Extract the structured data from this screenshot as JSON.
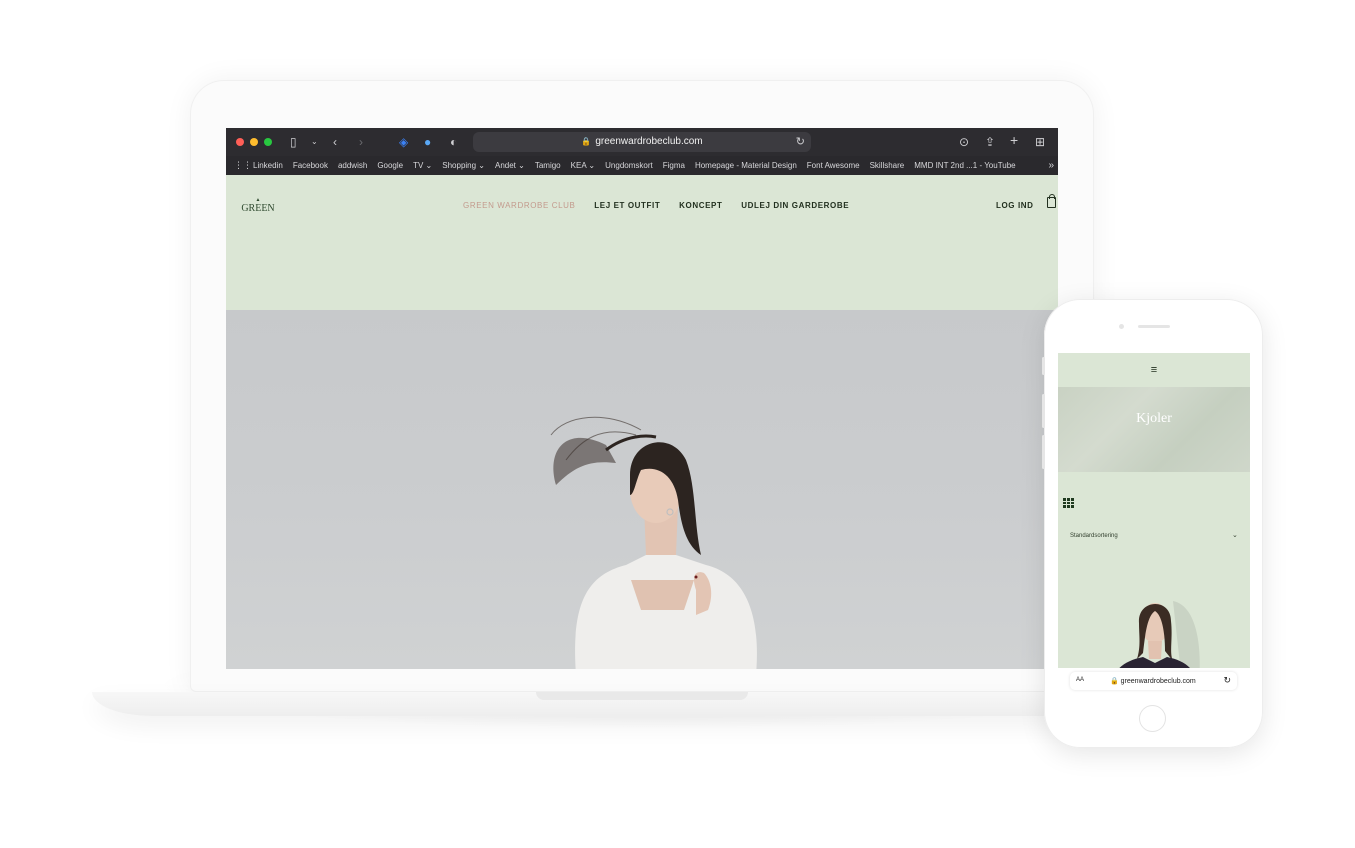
{
  "laptop": {
    "browser": {
      "url": "greenwardrobeclub.com",
      "bookmarks": [
        "Linkedin",
        "Facebook",
        "addwish",
        "Google",
        "TV ⌄",
        "Shopping ⌄",
        "Andet ⌄",
        "Tamigo",
        "KEA ⌄",
        "Ungdomskort",
        "Figma",
        "Homepage - Material Design",
        "Font Awesome",
        "Skillshare",
        "MMD INT 2nd ...1 - YouTube"
      ]
    },
    "site": {
      "logo": "GREEN",
      "nav": {
        "home": "GREEN WARDROBE CLUB",
        "rent": "LEJ ET OUTFIT",
        "concept": "KONCEPT",
        "lend": "UDLEJ DIN GARDEROBE"
      },
      "login": "LOG IND"
    }
  },
  "phone": {
    "menu_icon": "≡",
    "category_title": "Kjoler",
    "sort_label": "Standardsortering",
    "safari": {
      "aa": "AA",
      "url": "greenwardrobeclub.com"
    }
  },
  "colors": {
    "site_green": "#dbe6d5",
    "nav_active": "#c39a8d",
    "toolbar": "#2d2c30"
  }
}
